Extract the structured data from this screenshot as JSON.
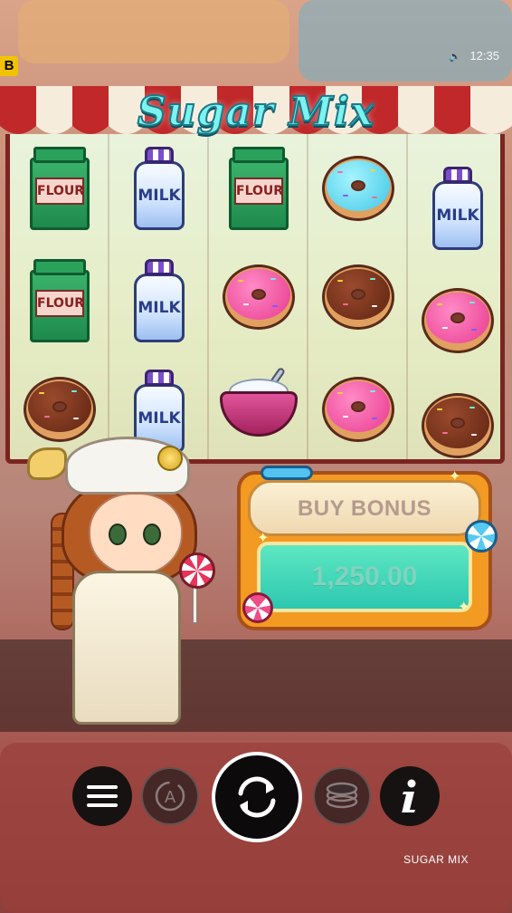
{
  "status_bar": {
    "badge": "B",
    "time": "12:35",
    "volume_icon": "speaker-icon"
  },
  "game": {
    "title": "Sugar Mix",
    "footer_name": "SUGAR MIX"
  },
  "reels": {
    "columns": [
      [
        "flour",
        "flour",
        "donut-chocolate"
      ],
      [
        "milk",
        "milk",
        "milk"
      ],
      [
        "flour",
        "donut-pink",
        "sugar-bowl"
      ],
      [
        "donut-blue",
        "donut-chocolate",
        "donut-pink"
      ],
      [
        "milk",
        "donut-pink",
        "donut-chocolate"
      ]
    ],
    "labels": {
      "flour": "FLOUR",
      "milk": "MILK"
    }
  },
  "buy_bonus": {
    "label": "BUY BONUS",
    "price": "1,250.00"
  },
  "controls": {
    "menu": "menu-icon",
    "autoplay": "autoplay-icon",
    "spin": "spin-icon",
    "bet": "coin-stack-icon",
    "info": "info-icon"
  },
  "colors": {
    "awning_red": "#c0282a",
    "title_cyan": "#7df3f0",
    "bonus_orange": "#f39a22",
    "bonus_teal": "#2cc7b0"
  }
}
